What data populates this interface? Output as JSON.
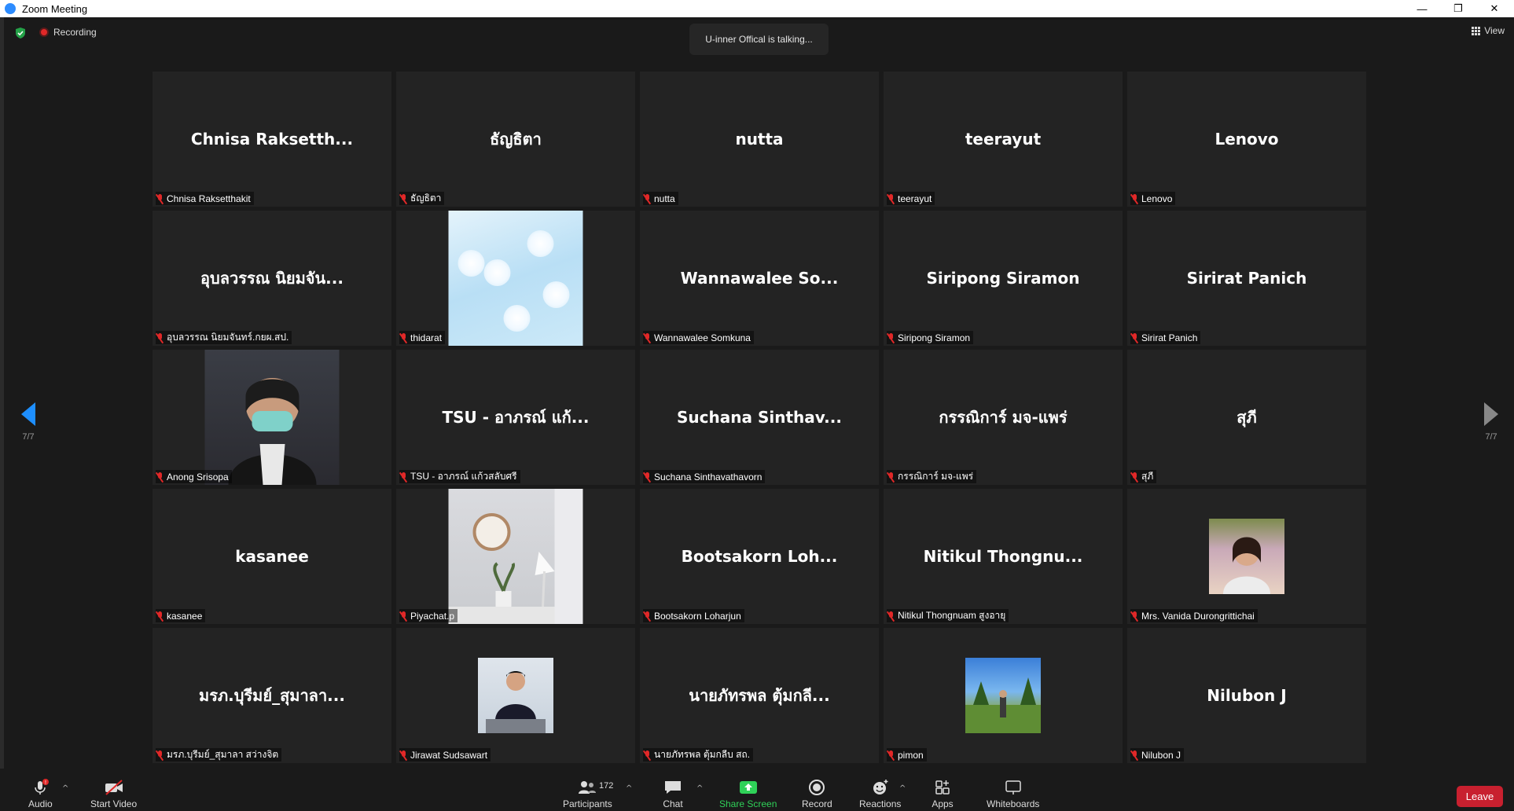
{
  "window": {
    "title": "Zoom Meeting",
    "minimize": "—",
    "restore": "❐",
    "close": "✕"
  },
  "top": {
    "recording": "Recording",
    "talking": "U-inner Offical is talking...",
    "view": "View"
  },
  "pager": {
    "left_count": "7/7",
    "right_count": "7/7"
  },
  "tiles": [
    {
      "big": "Chnisa  Raksetth...",
      "label": "Chnisa Raksetthakit",
      "video": null
    },
    {
      "big": "ธัญธิตา",
      "label": "ธัญธิตา",
      "video": null
    },
    {
      "big": "nutta",
      "label": "nutta",
      "video": null
    },
    {
      "big": "teerayut",
      "label": "teerayut",
      "video": null
    },
    {
      "big": "Lenovo",
      "label": "Lenovo",
      "video": null
    },
    {
      "big": "อุบลวรรณ  นิยมจัน...",
      "label": "อุบลวรรณ นิยมจันทร์.กยผ.สป.",
      "video": null
    },
    {
      "big": "",
      "label": "thidarat",
      "video": "flowers"
    },
    {
      "big": "Wannawalee  So...",
      "label": "Wannawalee Somkuna",
      "video": null
    },
    {
      "big": "Siripong Siramon",
      "label": "Siripong Siramon",
      "video": null
    },
    {
      "big": "Sirirat Panich",
      "label": "Sirirat Panich",
      "video": null
    },
    {
      "big": "",
      "label": "Anong Srisopa",
      "video": "person-mask"
    },
    {
      "big": "TSU - อาภรณ์  แก้...",
      "label": "TSU - อาภรณ์  แก้วสลับศรี",
      "video": null
    },
    {
      "big": "Suchana  Sinthav...",
      "label": "Suchana Sinthavathavorn",
      "video": null
    },
    {
      "big": "กรรณิการ์ มจ-แพร่",
      "label": "กรรณิการ์ มจ-แพร่",
      "video": null
    },
    {
      "big": "สุภี",
      "label": "สุภี",
      "video": null
    },
    {
      "big": "kasanee",
      "label": "kasanee",
      "video": null
    },
    {
      "big": "",
      "label": "Piyachat.p",
      "video": "room"
    },
    {
      "big": "Bootsakorn  Loh...",
      "label": "Bootsakorn Loharjun",
      "video": null
    },
    {
      "big": "Nitikul  Thongnu...",
      "label": "Nitikul Thongnuam สูงอายุ",
      "video": null
    },
    {
      "big": "",
      "label": "Mrs. Vanida Durongrittichai",
      "video": "woman"
    },
    {
      "big": "มรภ.บุรีมย์_สุมาลา...",
      "label": "มรภ.บุรีมย์_สุมาลา สว่างจิต",
      "video": null
    },
    {
      "big": "",
      "label": "Jirawat Sudsawart",
      "video": "man"
    },
    {
      "big": "นายภัทรพล  ตุ้มกลี...",
      "label": "นายภัทรพล ตุ้มกลีบ สถ.",
      "video": null
    },
    {
      "big": "",
      "label": "pimon",
      "video": "outdoor"
    },
    {
      "big": "Nilubon J",
      "label": "Nilubon J",
      "video": null
    }
  ],
  "toolbar": {
    "audio": "Audio",
    "start_video": "Start Video",
    "participants_count": "172",
    "participants": "Participants",
    "chat": "Chat",
    "share_screen": "Share Screen",
    "record": "Record",
    "reactions": "Reactions",
    "apps": "Apps",
    "whiteboards": "Whiteboards",
    "leave": "Leave"
  },
  "colors": {
    "accent_blue": "#1e8fff",
    "leave_red": "#c8202f",
    "share_green": "#2fd158",
    "mute_red": "#e02828"
  }
}
